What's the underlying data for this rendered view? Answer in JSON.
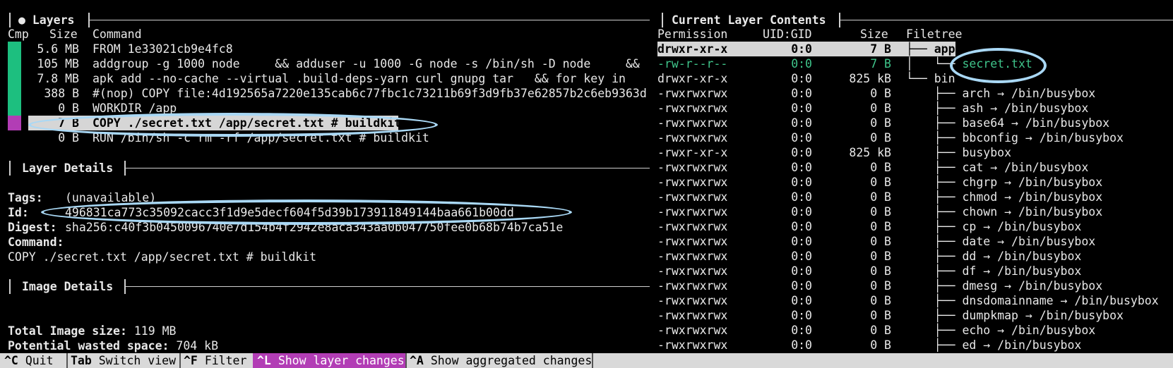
{
  "layers_panel": {
    "title": "● Layers",
    "col_cmp": "Cmp",
    "col_size": "Size",
    "col_command": "Command",
    "rows": [
      {
        "size": "5.6 MB",
        "command": "FROM 1e33021cb9e4fc8",
        "cmp_color": "#1dbf7f"
      },
      {
        "size": "105 MB",
        "command": "addgroup -g 1000 node     && adduser -u 1000 -G node -s /bin/sh -D node     &&",
        "cmp_color": "#1dbf7f"
      },
      {
        "size": "7.8 MB",
        "command": "apk add --no-cache --virtual .build-deps-yarn curl gnupg tar   && for key in",
        "cmp_color": "#1dbf7f"
      },
      {
        "size": "388 B",
        "command": "#(nop) COPY file:4d192565a7220e135cab6c77fbc1c73211b69f3d9fb37e62857b2c6eb9363d",
        "cmp_color": "#1dbf7f"
      },
      {
        "size": "0 B",
        "command": "WORKDIR /app",
        "cmp_color": "#1dbf7f"
      },
      {
        "size": "7 B",
        "command": "COPY ./secret.txt /app/secret.txt # buildkit",
        "cmp_color": "#b23db5"
      },
      {
        "size": "0 B",
        "command": "RUN /bin/sh -c rm -rf /app/secret.txt # buildkit",
        "cmp_color": ""
      }
    ]
  },
  "layer_details": {
    "title": "Layer Details",
    "tags_label": "Tags:",
    "tags_value": "(unavailable)",
    "id_label": "Id:",
    "id_value": "496831ca773c35092cacc3f1d9e5decf604f5d39b173911849144baa661b00dd",
    "digest_label": "Digest:",
    "digest_value": "sha256:c40f3b0450096740e7d154b4f2942e8aca343aa0b047750fee0b68b74b7ca51e",
    "command_label": "Command:",
    "command_value": "COPY ./secret.txt /app/secret.txt # buildkit"
  },
  "image_details": {
    "title": "Image Details",
    "total_label": "Total Image size:",
    "total_value": "119 MB",
    "wasted_label": "Potential wasted space:",
    "wasted_value": "704 kB"
  },
  "contents_panel": {
    "title": "Current Layer Contents",
    "col_permission": "Permission",
    "col_uid": "UID:GID",
    "col_size": "Size",
    "col_tree": "Filetree",
    "rows": [
      {
        "perm": "drwxr-xr-x",
        "uid": "0:0",
        "size": "7 B",
        "tree": "├── app",
        "style": "sel"
      },
      {
        "perm": "-rw-r--r--",
        "uid": "0:0",
        "size": "7 B",
        "tree": "│   └── secret.txt",
        "style": "green"
      },
      {
        "perm": "drwxr-xr-x",
        "uid": "0:0",
        "size": "825 kB",
        "tree": "└── bin",
        "style": ""
      },
      {
        "perm": "-rwxrwxrwx",
        "uid": "0:0",
        "size": "0 B",
        "tree": "    ├── arch → /bin/busybox",
        "style": ""
      },
      {
        "perm": "-rwxrwxrwx",
        "uid": "0:0",
        "size": "0 B",
        "tree": "    ├── ash → /bin/busybox",
        "style": ""
      },
      {
        "perm": "-rwxrwxrwx",
        "uid": "0:0",
        "size": "0 B",
        "tree": "    ├── base64 → /bin/busybox",
        "style": ""
      },
      {
        "perm": "-rwxrwxrwx",
        "uid": "0:0",
        "size": "0 B",
        "tree": "    ├── bbconfig → /bin/busybox",
        "style": ""
      },
      {
        "perm": "-rwxr-xr-x",
        "uid": "0:0",
        "size": "825 kB",
        "tree": "    ├── busybox",
        "style": ""
      },
      {
        "perm": "-rwxrwxrwx",
        "uid": "0:0",
        "size": "0 B",
        "tree": "    ├── cat → /bin/busybox",
        "style": ""
      },
      {
        "perm": "-rwxrwxrwx",
        "uid": "0:0",
        "size": "0 B",
        "tree": "    ├── chgrp → /bin/busybox",
        "style": ""
      },
      {
        "perm": "-rwxrwxrwx",
        "uid": "0:0",
        "size": "0 B",
        "tree": "    ├── chmod → /bin/busybox",
        "style": ""
      },
      {
        "perm": "-rwxrwxrwx",
        "uid": "0:0",
        "size": "0 B",
        "tree": "    ├── chown → /bin/busybox",
        "style": ""
      },
      {
        "perm": "-rwxrwxrwx",
        "uid": "0:0",
        "size": "0 B",
        "tree": "    ├── cp → /bin/busybox",
        "style": ""
      },
      {
        "perm": "-rwxrwxrwx",
        "uid": "0:0",
        "size": "0 B",
        "tree": "    ├── date → /bin/busybox",
        "style": ""
      },
      {
        "perm": "-rwxrwxrwx",
        "uid": "0:0",
        "size": "0 B",
        "tree": "    ├── dd → /bin/busybox",
        "style": ""
      },
      {
        "perm": "-rwxrwxrwx",
        "uid": "0:0",
        "size": "0 B",
        "tree": "    ├── df → /bin/busybox",
        "style": ""
      },
      {
        "perm": "-rwxrwxrwx",
        "uid": "0:0",
        "size": "0 B",
        "tree": "    ├── dmesg → /bin/busybox",
        "style": ""
      },
      {
        "perm": "-rwxrwxrwx",
        "uid": "0:0",
        "size": "0 B",
        "tree": "    ├── dnsdomainname → /bin/busybox",
        "style": ""
      },
      {
        "perm": "-rwxrwxrwx",
        "uid": "0:0",
        "size": "0 B",
        "tree": "    ├── dumpkmap → /bin/busybox",
        "style": ""
      },
      {
        "perm": "-rwxrwxrwx",
        "uid": "0:0",
        "size": "0 B",
        "tree": "    ├── echo → /bin/busybox",
        "style": ""
      },
      {
        "perm": "-rwxrwxrwx",
        "uid": "0:0",
        "size": "0 B",
        "tree": "    ├── ed → /bin/busybox",
        "style": ""
      }
    ]
  },
  "statusbar": [
    {
      "key": "^C",
      "label": "Quit",
      "active": false
    },
    {
      "key": "Tab",
      "label": "Switch view",
      "active": false
    },
    {
      "key": "^F",
      "label": "Filter",
      "active": false
    },
    {
      "key": "^L",
      "label": "Show layer changes",
      "active": true
    },
    {
      "key": "^A",
      "label": "Show aggregated changes",
      "active": false
    }
  ],
  "colors": {
    "accent_green": "#1dbf7f",
    "accent_purple": "#b23db5",
    "annotation_blue": "#a9d8f5"
  }
}
